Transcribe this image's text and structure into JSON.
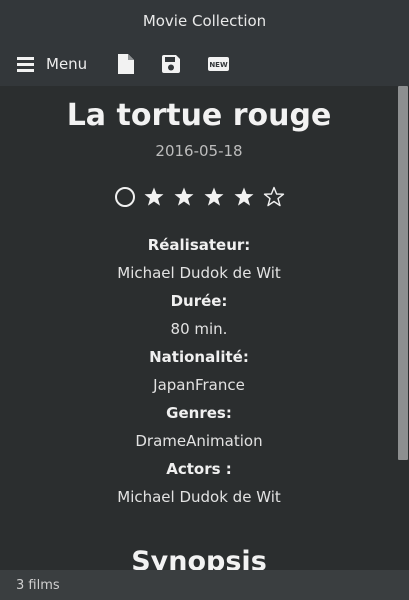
{
  "window": {
    "title": "Movie Collection"
  },
  "toolbar": {
    "menu_label": "Menu",
    "icons": [
      "hamburger-icon",
      "new-document-icon",
      "save-icon",
      "new-badge-icon"
    ],
    "new_badge_text": "NEW"
  },
  "film": {
    "title": "La tortue rouge",
    "date": "2016-05-18",
    "rating": {
      "value": 4,
      "max": 5
    },
    "fields": [
      {
        "label": "Réalisateur:",
        "value": "Michael Dudok de Wit"
      },
      {
        "label": "Durée:",
        "value": "80 min."
      },
      {
        "label": "Nationalité:",
        "value": "JapanFrance"
      },
      {
        "label": "Genres:",
        "value": "DrameAnimation"
      },
      {
        "label": "Actors :",
        "value": "Michael Dudok de Wit"
      }
    ],
    "synopsis_title": "Synopsis"
  },
  "status": {
    "text": "3 films"
  },
  "colors": {
    "bar": "#33373a",
    "content": "#2b2e2f",
    "statusbar": "#3a3e40",
    "scroll_thumb": "#8d8f90"
  }
}
